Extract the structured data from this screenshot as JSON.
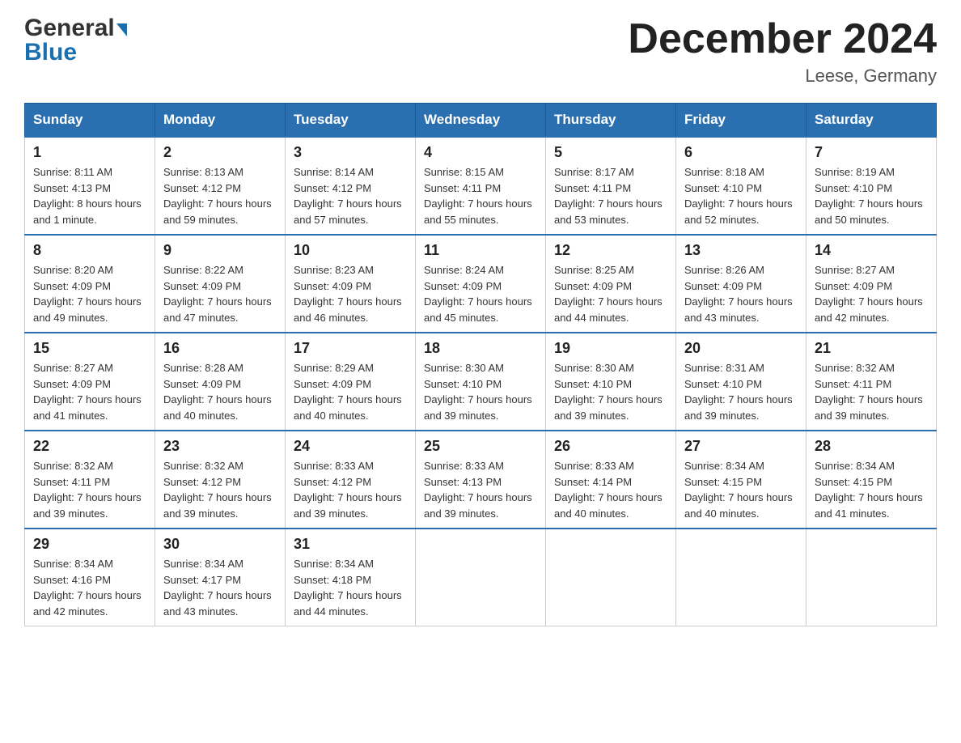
{
  "header": {
    "logo_text1": "General",
    "logo_text2": "Blue",
    "title": "December 2024",
    "subtitle": "Leese, Germany"
  },
  "weekdays": [
    "Sunday",
    "Monday",
    "Tuesday",
    "Wednesday",
    "Thursday",
    "Friday",
    "Saturday"
  ],
  "weeks": [
    [
      {
        "day": "1",
        "sunrise": "8:11 AM",
        "sunset": "4:13 PM",
        "daylight": "8 hours and 1 minute."
      },
      {
        "day": "2",
        "sunrise": "8:13 AM",
        "sunset": "4:12 PM",
        "daylight": "7 hours and 59 minutes."
      },
      {
        "day": "3",
        "sunrise": "8:14 AM",
        "sunset": "4:12 PM",
        "daylight": "7 hours and 57 minutes."
      },
      {
        "day": "4",
        "sunrise": "8:15 AM",
        "sunset": "4:11 PM",
        "daylight": "7 hours and 55 minutes."
      },
      {
        "day": "5",
        "sunrise": "8:17 AM",
        "sunset": "4:11 PM",
        "daylight": "7 hours and 53 minutes."
      },
      {
        "day": "6",
        "sunrise": "8:18 AM",
        "sunset": "4:10 PM",
        "daylight": "7 hours and 52 minutes."
      },
      {
        "day": "7",
        "sunrise": "8:19 AM",
        "sunset": "4:10 PM",
        "daylight": "7 hours and 50 minutes."
      }
    ],
    [
      {
        "day": "8",
        "sunrise": "8:20 AM",
        "sunset": "4:09 PM",
        "daylight": "7 hours and 49 minutes."
      },
      {
        "day": "9",
        "sunrise": "8:22 AM",
        "sunset": "4:09 PM",
        "daylight": "7 hours and 47 minutes."
      },
      {
        "day": "10",
        "sunrise": "8:23 AM",
        "sunset": "4:09 PM",
        "daylight": "7 hours and 46 minutes."
      },
      {
        "day": "11",
        "sunrise": "8:24 AM",
        "sunset": "4:09 PM",
        "daylight": "7 hours and 45 minutes."
      },
      {
        "day": "12",
        "sunrise": "8:25 AM",
        "sunset": "4:09 PM",
        "daylight": "7 hours and 44 minutes."
      },
      {
        "day": "13",
        "sunrise": "8:26 AM",
        "sunset": "4:09 PM",
        "daylight": "7 hours and 43 minutes."
      },
      {
        "day": "14",
        "sunrise": "8:27 AM",
        "sunset": "4:09 PM",
        "daylight": "7 hours and 42 minutes."
      }
    ],
    [
      {
        "day": "15",
        "sunrise": "8:27 AM",
        "sunset": "4:09 PM",
        "daylight": "7 hours and 41 minutes."
      },
      {
        "day": "16",
        "sunrise": "8:28 AM",
        "sunset": "4:09 PM",
        "daylight": "7 hours and 40 minutes."
      },
      {
        "day": "17",
        "sunrise": "8:29 AM",
        "sunset": "4:09 PM",
        "daylight": "7 hours and 40 minutes."
      },
      {
        "day": "18",
        "sunrise": "8:30 AM",
        "sunset": "4:10 PM",
        "daylight": "7 hours and 39 minutes."
      },
      {
        "day": "19",
        "sunrise": "8:30 AM",
        "sunset": "4:10 PM",
        "daylight": "7 hours and 39 minutes."
      },
      {
        "day": "20",
        "sunrise": "8:31 AM",
        "sunset": "4:10 PM",
        "daylight": "7 hours and 39 minutes."
      },
      {
        "day": "21",
        "sunrise": "8:32 AM",
        "sunset": "4:11 PM",
        "daylight": "7 hours and 39 minutes."
      }
    ],
    [
      {
        "day": "22",
        "sunrise": "8:32 AM",
        "sunset": "4:11 PM",
        "daylight": "7 hours and 39 minutes."
      },
      {
        "day": "23",
        "sunrise": "8:32 AM",
        "sunset": "4:12 PM",
        "daylight": "7 hours and 39 minutes."
      },
      {
        "day": "24",
        "sunrise": "8:33 AM",
        "sunset": "4:12 PM",
        "daylight": "7 hours and 39 minutes."
      },
      {
        "day": "25",
        "sunrise": "8:33 AM",
        "sunset": "4:13 PM",
        "daylight": "7 hours and 39 minutes."
      },
      {
        "day": "26",
        "sunrise": "8:33 AM",
        "sunset": "4:14 PM",
        "daylight": "7 hours and 40 minutes."
      },
      {
        "day": "27",
        "sunrise": "8:34 AM",
        "sunset": "4:15 PM",
        "daylight": "7 hours and 40 minutes."
      },
      {
        "day": "28",
        "sunrise": "8:34 AM",
        "sunset": "4:15 PM",
        "daylight": "7 hours and 41 minutes."
      }
    ],
    [
      {
        "day": "29",
        "sunrise": "8:34 AM",
        "sunset": "4:16 PM",
        "daylight": "7 hours and 42 minutes."
      },
      {
        "day": "30",
        "sunrise": "8:34 AM",
        "sunset": "4:17 PM",
        "daylight": "7 hours and 43 minutes."
      },
      {
        "day": "31",
        "sunrise": "8:34 AM",
        "sunset": "4:18 PM",
        "daylight": "7 hours and 44 minutes."
      },
      null,
      null,
      null,
      null
    ]
  ]
}
